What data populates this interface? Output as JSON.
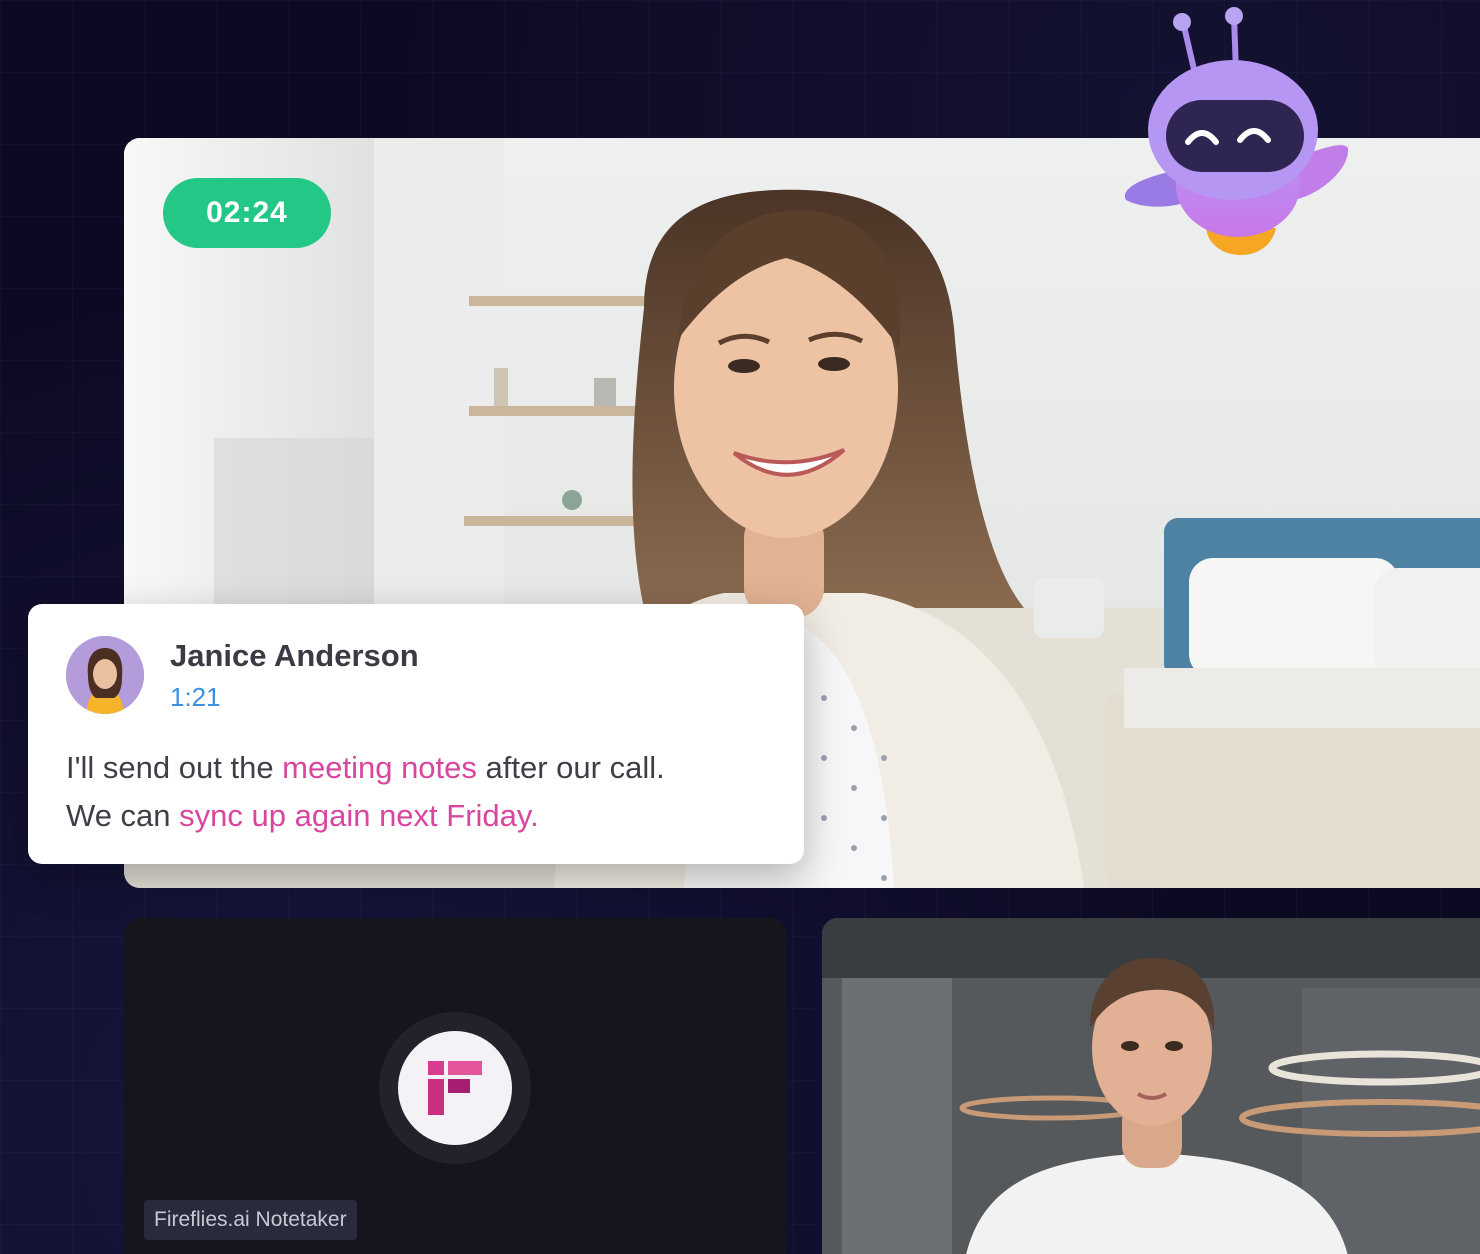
{
  "call": {
    "timer": "02:24"
  },
  "caption": {
    "speaker_name": "Janice Anderson",
    "timestamp": "1:21",
    "segments": [
      {
        "text": "I'll send out the ",
        "highlight": false
      },
      {
        "text": "meeting notes",
        "highlight": true
      },
      {
        "text": " after our call.",
        "highlight": false
      },
      {
        "text": "We can ",
        "highlight": false,
        "newline": true
      },
      {
        "text": "sync up again next Friday.",
        "highlight": true
      }
    ]
  },
  "participants": {
    "notetaker_label": "Fireflies.ai Notetaker"
  },
  "icons": {
    "mascot": "robot-mascot-icon",
    "notetaker_logo": "fireflies-logo-icon"
  },
  "colors": {
    "timer_bg": "#23c887",
    "highlight": "#d9469e",
    "timestamp": "#3d8fe0",
    "background": "#0c0a22"
  }
}
